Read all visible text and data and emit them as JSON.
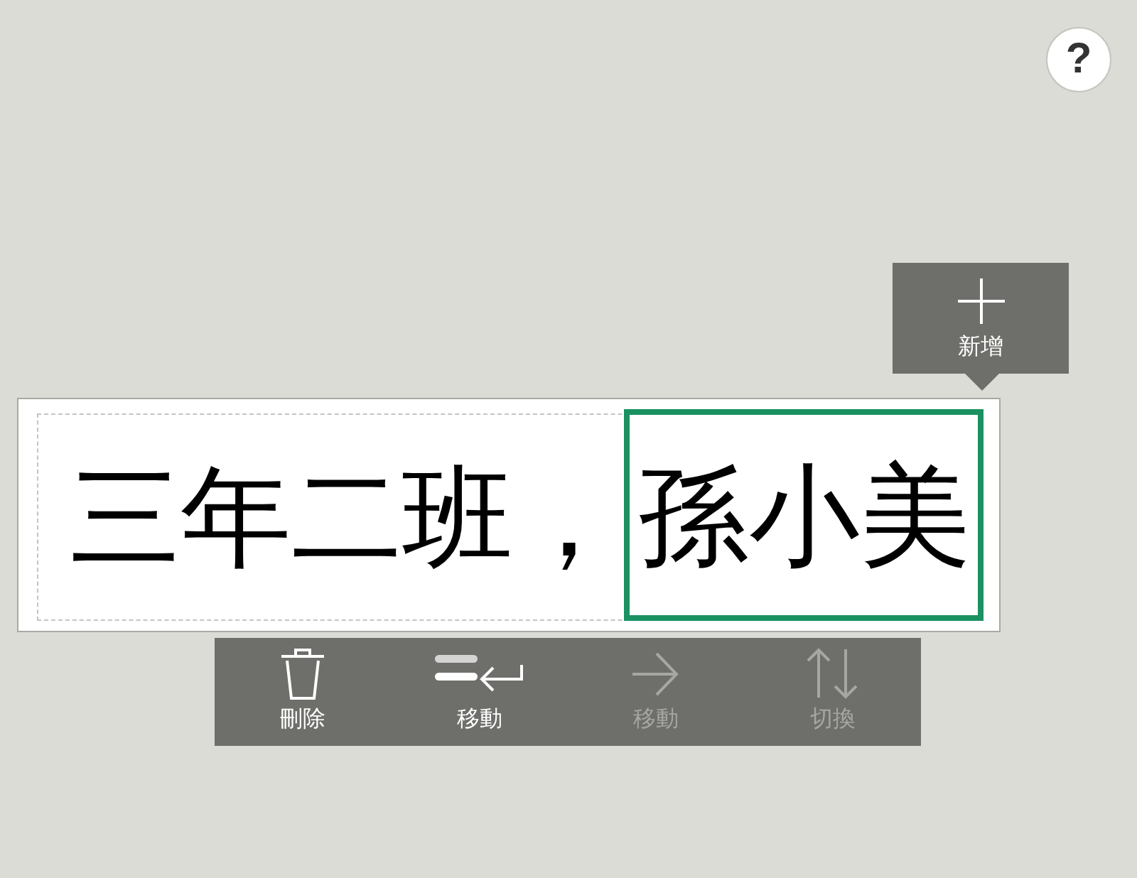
{
  "help_button": {
    "label": "?"
  },
  "add_button": {
    "label": "新增"
  },
  "editor": {
    "segments": [
      {
        "text": "三年二班，",
        "selected": false
      },
      {
        "text": "孫小美",
        "selected": true
      }
    ]
  },
  "toolbar": {
    "buttons": [
      {
        "kind": "delete",
        "label": "刪除",
        "disabled": false
      },
      {
        "kind": "move_back",
        "label": "移動",
        "disabled": false
      },
      {
        "kind": "move_forward",
        "label": "移動",
        "disabled": true
      },
      {
        "kind": "swap",
        "label": "切換",
        "disabled": true
      }
    ]
  }
}
